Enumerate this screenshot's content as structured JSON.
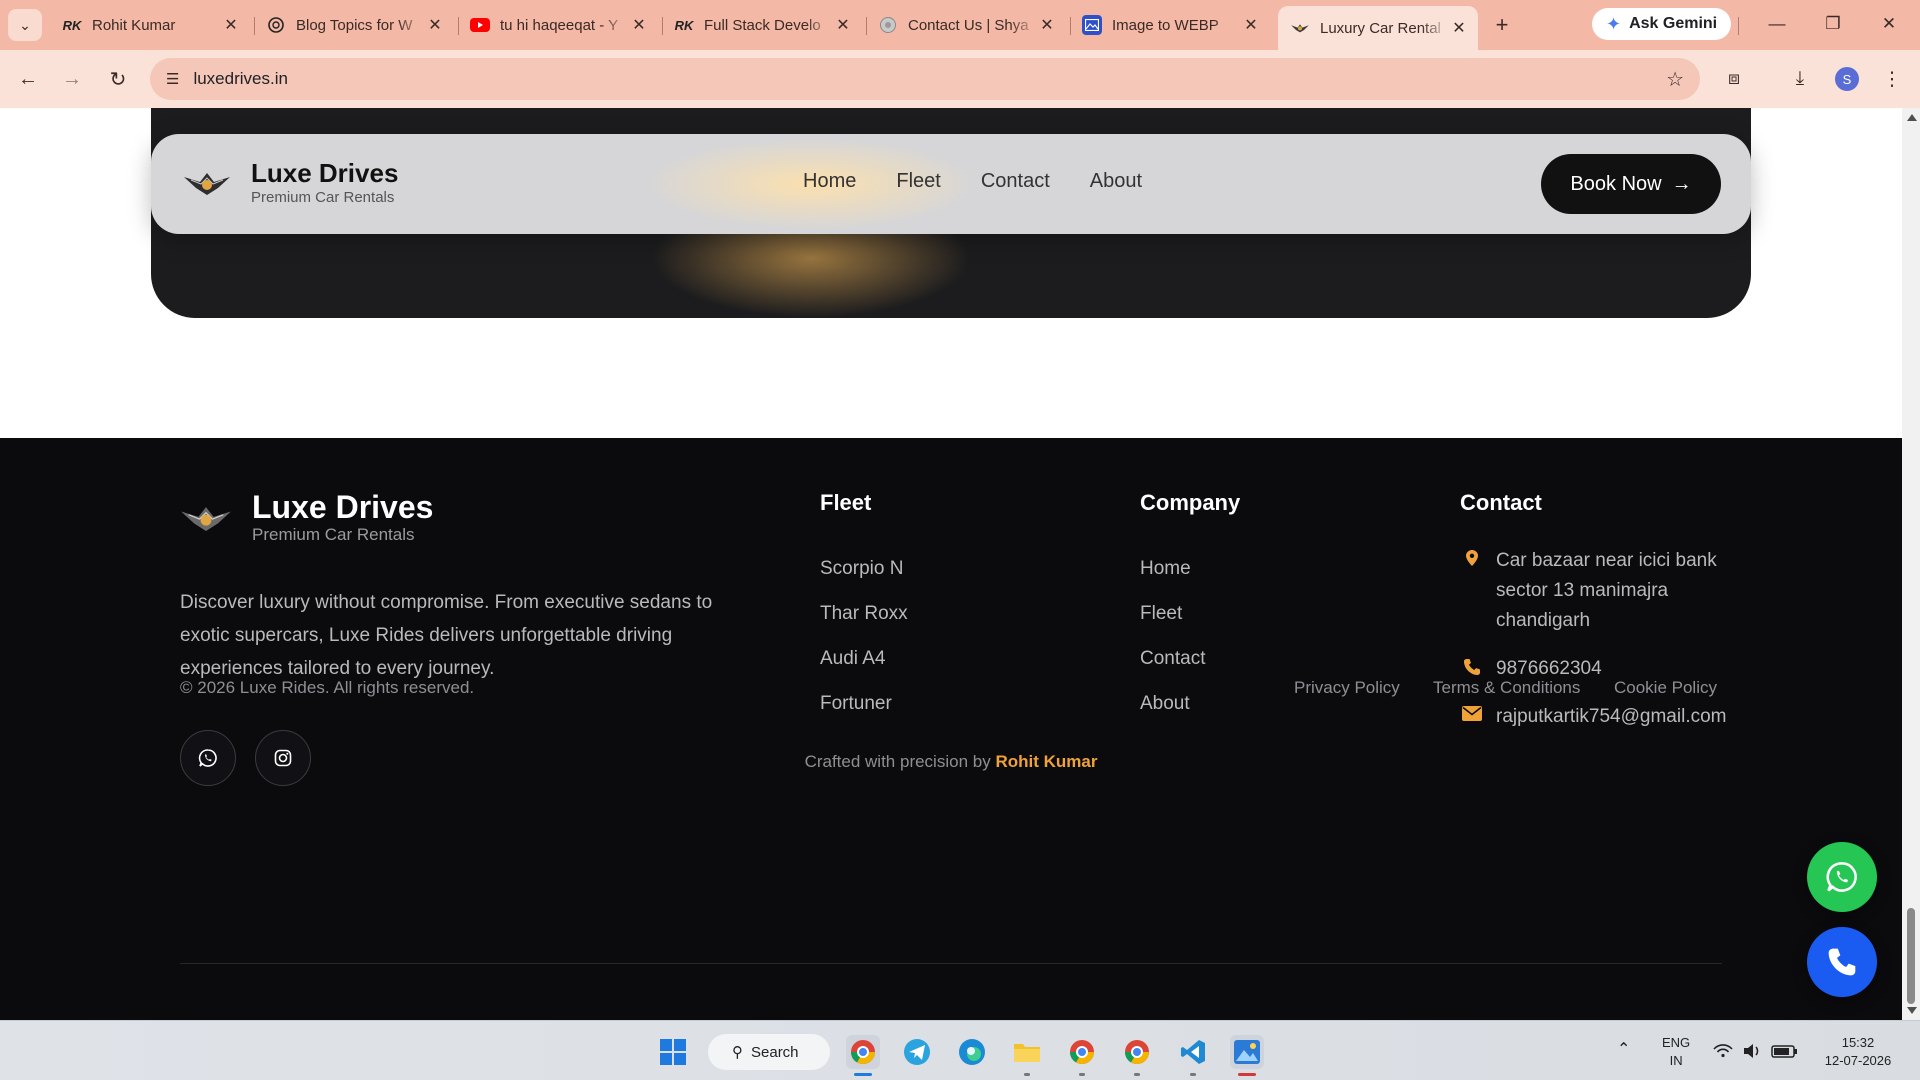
{
  "browser": {
    "tabs": [
      {
        "title": "Rohit Kumar",
        "icon": "rk-logo-icon"
      },
      {
        "title": "Blog Topics for W",
        "icon": "chatgpt-icon"
      },
      {
        "title": "tu hi haqeeqat - Y",
        "icon": "youtube-icon"
      },
      {
        "title": "Full Stack Develo",
        "icon": "rk-logo-icon"
      },
      {
        "title": "Contact Us | Shya",
        "icon": "globe-icon"
      },
      {
        "title": "Image to WEBP",
        "icon": "image-converter-icon"
      },
      {
        "title": "Luxury Car Rental",
        "icon": "luxe-logo-icon",
        "active": true
      }
    ],
    "gemini_label": "Ask Gemini",
    "url": "luxedrives.in",
    "profile_initial": "S"
  },
  "navbar": {
    "brand_name": "Luxe Drives",
    "brand_tagline": "Premium Car Rentals",
    "links": [
      "Home",
      "Fleet",
      "Contact",
      "About"
    ],
    "cta_label": "Book Now"
  },
  "footer": {
    "brand_name": "Luxe Drives",
    "brand_tagline": "Premium Car Rentals",
    "description": "Discover luxury without compromise. From executive sedans to exotic supercars, Luxe Rides delivers unforgettable driving experiences tailored to every journey.",
    "fleet": {
      "heading": "Fleet",
      "links": [
        "Scorpio N",
        "Thar Roxx",
        "Audi A4",
        "Fortuner"
      ]
    },
    "company": {
      "heading": "Company",
      "links": [
        "Home",
        "Fleet",
        "Contact",
        "About"
      ]
    },
    "contact": {
      "heading": "Contact",
      "address": "Car bazaar near icici bank sector 13 manimajra chandigarh",
      "phone": "9876662304",
      "email": "rajputkartik754@gmail.com"
    },
    "copyright": "© 2026 Luxe Rides. All rights reserved.",
    "legal": [
      "Privacy Policy",
      "Terms & Conditions",
      "Cookie Policy"
    ],
    "crafted_prefix": "Crafted with precision by",
    "crafted_author": "Rohit Kumar"
  },
  "taskbar": {
    "search_label": "Search",
    "lang_line1": "ENG",
    "lang_line2": "IN",
    "time": "15:32",
    "date": "12-07-2026"
  },
  "colors": {
    "accent": "#f0a23a",
    "whatsapp": "#25c654",
    "call": "#1a5cf2",
    "footer_bg": "#0b0b0e",
    "tabbar_bg": "#f3b8a6"
  }
}
